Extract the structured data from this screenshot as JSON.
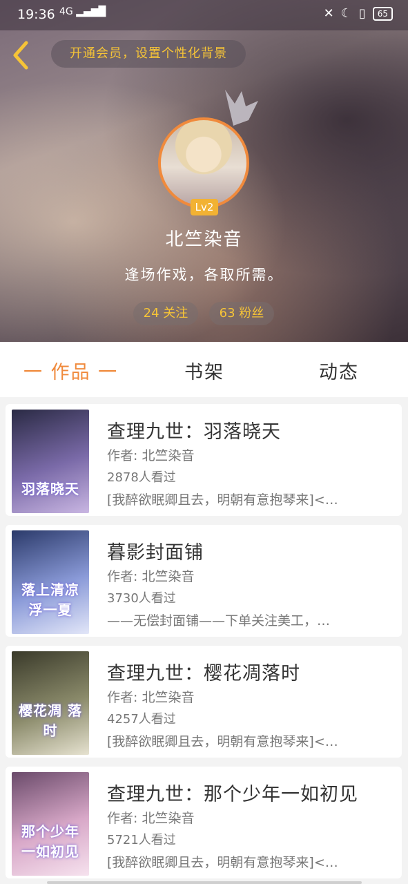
{
  "status_bar": {
    "time": "19:36",
    "signal": "4G",
    "battery": "65"
  },
  "header": {
    "vip_prompt": "开通会员，设置个性化背景"
  },
  "profile": {
    "level": "Lv2",
    "username": "北竺染音",
    "signature": "逢场作戏，各取所需。",
    "following": "24 关注",
    "fans": "63 粉丝"
  },
  "tabs": [
    {
      "label": "一 作品 一",
      "active": true
    },
    {
      "label": "书架",
      "active": false
    },
    {
      "label": "动态",
      "active": false
    }
  ],
  "books": [
    {
      "title": "查理九世：羽落晓天",
      "author": "作者: 北竺染音",
      "views": "2878人看过",
      "desc": "[我醉欲眠卿且去，明朝有意抱琴来]<…",
      "cover_text": "羽落晓天",
      "cover_colors": [
        "#2a2a44",
        "#7a6aa8",
        "#c9b6e2"
      ]
    },
    {
      "title": "暮影封面铺",
      "author": "作者: 北竺染音",
      "views": "3730人看过",
      "desc": "——无偿封面铺——下单关注美工，…",
      "cover_text": "落上清凉 浮一夏",
      "cover_colors": [
        "#2b3a6a",
        "#8a9ad8",
        "#e2e6f8"
      ]
    },
    {
      "title": "查理九世：樱花凋落时",
      "author": "作者: 北竺染音",
      "views": "4257人看过",
      "desc": "[我醉欲眠卿且去，明朝有意抱琴来]<…",
      "cover_text": "樱花凋 落时",
      "cover_colors": [
        "#3a3a2a",
        "#8a8a6a",
        "#e6e2d0"
      ]
    },
    {
      "title": "查理九世：那个少年一如初见",
      "author": "作者: 北竺染音",
      "views": "5721人看过",
      "desc": "[我醉欲眠卿且去，明朝有意抱琴来]<…",
      "cover_text": "那个少年 一如初见",
      "cover_colors": [
        "#6a4a6a",
        "#d8a8c8",
        "#f6e2ee"
      ]
    }
  ]
}
